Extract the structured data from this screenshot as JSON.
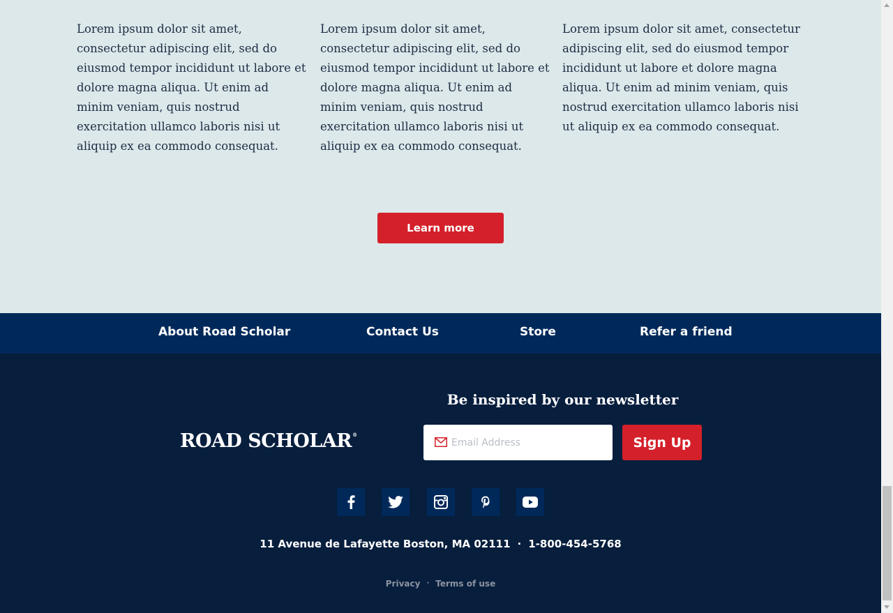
{
  "content": {
    "columns": [
      "Lorem ipsum dolor sit amet, consectetur adipiscing elit, sed do eiusmod tempor incididunt ut labore et dolore magna aliqua. Ut enim ad minim veniam, quis nostrud exercitation ullamco laboris nisi ut aliquip ex ea commodo consequat.",
      "Lorem ipsum dolor sit amet, consectetur adipiscing elit, sed do eiusmod tempor incididunt ut labore et dolore magna aliqua. Ut enim ad minim veniam, quis nostrud exercitation ullamco laboris nisi ut aliquip ex ea commodo consequat.",
      "Lorem ipsum dolor sit amet, consectetur adipiscing elit, sed do eiusmod tempor incididunt ut labore et dolore magna aliqua. Ut enim ad minim veniam, quis nostrud exercitation ullamco laboris nisi ut aliquip ex ea commodo consequat."
    ],
    "learn_more_label": "Learn more"
  },
  "nav": {
    "items": [
      {
        "label": "About Road Scholar"
      },
      {
        "label": "Contact Us"
      },
      {
        "label": "Store"
      },
      {
        "label": "Refer a friend"
      }
    ]
  },
  "footer": {
    "logo_text": "ROAD SCHOLAR",
    "logo_mark": "®",
    "newsletter_title": "Be inspired by our newsletter",
    "email_placeholder": "Email Address",
    "signup_label": "Sign Up",
    "social_icons": [
      "facebook-icon",
      "twitter-icon",
      "instagram-icon",
      "pinterest-icon",
      "youtube-icon"
    ],
    "address": "11 Avenue de Lafayette Boston, MA 02111",
    "address_separator": "·",
    "phone": "1-800-454-5768",
    "privacy_label": "Privacy",
    "legal_separator": "·",
    "terms_label": "Terms of use"
  },
  "colors": {
    "content_bg": "#dde8eb",
    "nav_bg": "#00295a",
    "footer_bg": "#071e3d",
    "accent_red": "#d4202a"
  }
}
